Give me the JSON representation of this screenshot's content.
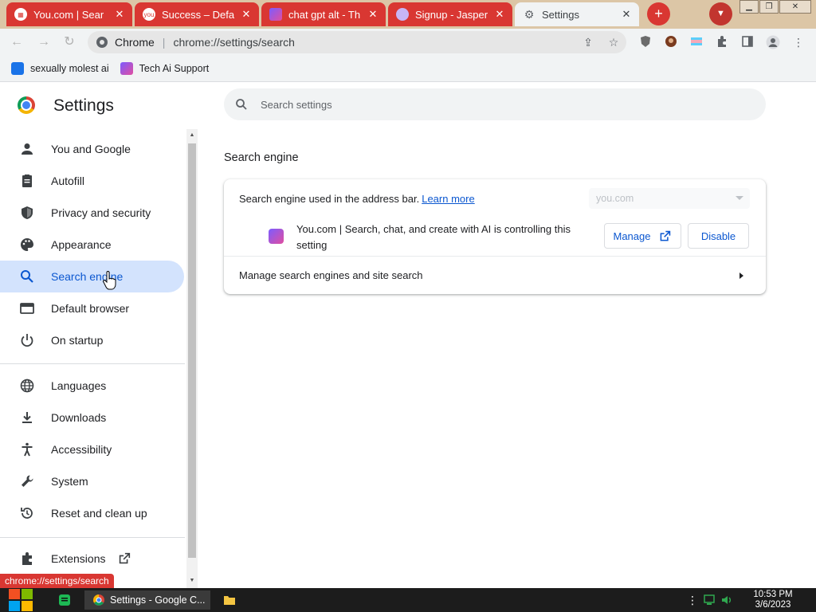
{
  "tabs": [
    {
      "title": "You.com | Sear",
      "favicon": "youcom-tab-icon"
    },
    {
      "title": "Success – Defa",
      "favicon": "you-circle-icon"
    },
    {
      "title": "chat gpt alt - Th",
      "favicon": "youcom-logo-icon"
    },
    {
      "title": "Signup - Jasper",
      "favicon": "jasper-icon"
    },
    {
      "title": "Settings",
      "favicon": "gear-icon"
    }
  ],
  "address_bar": {
    "site_name": "Chrome",
    "url": "chrome://settings/search"
  },
  "bookmarks": [
    {
      "label": "sexually molest ai",
      "icon": "bookmark-icon"
    },
    {
      "label": "Tech Ai Support",
      "icon": "youcom-logo-icon"
    }
  ],
  "settings": {
    "title": "Settings",
    "search_placeholder": "Search settings"
  },
  "sidebar": {
    "items": [
      {
        "label": "You and Google",
        "icon": "person-icon"
      },
      {
        "label": "Autofill",
        "icon": "clipboard-icon"
      },
      {
        "label": "Privacy and security",
        "icon": "shield-icon"
      },
      {
        "label": "Appearance",
        "icon": "palette-icon"
      },
      {
        "label": "Search engine",
        "icon": "search-icon",
        "active": true
      },
      {
        "label": "Default browser",
        "icon": "browser-icon"
      },
      {
        "label": "On startup",
        "icon": "power-icon"
      },
      {
        "label": "Languages",
        "icon": "globe-icon"
      },
      {
        "label": "Downloads",
        "icon": "download-icon"
      },
      {
        "label": "Accessibility",
        "icon": "accessibility-icon"
      },
      {
        "label": "System",
        "icon": "wrench-icon"
      },
      {
        "label": "Reset and clean up",
        "icon": "reset-icon"
      },
      {
        "label": "Extensions",
        "icon": "puzzle-icon"
      }
    ]
  },
  "search_engine": {
    "section_title": "Search engine",
    "address_bar_label": "Search engine used in the address bar.",
    "learn_more": "Learn more",
    "selected_engine": "you.com",
    "extension_notice": "You.com | Search, chat, and create with AI is controlling this setting",
    "manage_button": "Manage",
    "disable_button": "Disable",
    "manage_engines_label": "Manage search engines and site search"
  },
  "status_bar_url": "chrome://settings/search",
  "taskbar": {
    "app_label": "Settings - Google C...",
    "time": "10:53 PM",
    "date": "3/6/2023"
  },
  "colors": {
    "tab_red": "#d93732",
    "accent_blue": "#0b57d0",
    "active_nav_bg": "#d3e3fd"
  }
}
